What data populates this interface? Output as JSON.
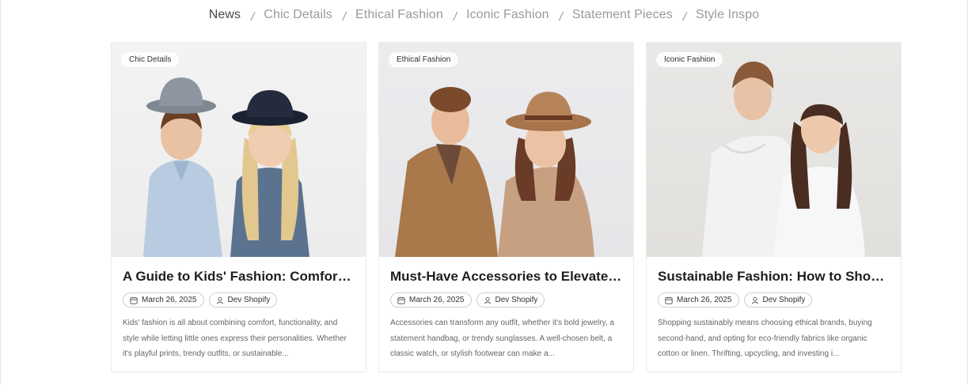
{
  "tabs": [
    {
      "label": "News",
      "active": true
    },
    {
      "label": "Chic Details",
      "active": false
    },
    {
      "label": "Ethical Fashion",
      "active": false
    },
    {
      "label": "Iconic Fashion",
      "active": false
    },
    {
      "label": "Statement Pieces",
      "active": false
    },
    {
      "label": "Style Inspo",
      "active": false
    }
  ],
  "separator": "/",
  "cards": [
    {
      "badge": "Chic Details",
      "title": "A Guide to Kids' Fashion: Comfort, Sty...",
      "date": "March 26, 2025",
      "author": "Dev Shopify",
      "excerpt": "Kids' fashion is all about combining comfort, functionality, and style while letting little ones express their personalities. Whether it's playful prints, trendy outfits, or sustainable..."
    },
    {
      "badge": "Ethical Fashion",
      "title": "Must-Have Accessories to Elevate An...",
      "date": "March 26, 2025",
      "author": "Dev Shopify",
      "excerpt": "Accessories can transform any outfit, whether it's bold jewelry, a statement handbag, or trendy sunglasses. A well-chosen belt, a classic watch, or stylish footwear can make a..."
    },
    {
      "badge": "Iconic Fashion",
      "title": "Sustainable Fashion: How to Shop...",
      "date": "March 26, 2025",
      "author": "Dev Shopify",
      "excerpt": "Shopping sustainably means choosing ethical brands, buying second-hand, and opting for eco-friendly fabrics like organic cotton or linen. Thrifting, upcycling, and investing i..."
    }
  ],
  "icons": {
    "date": "calendar-icon",
    "author": "user-icon"
  }
}
